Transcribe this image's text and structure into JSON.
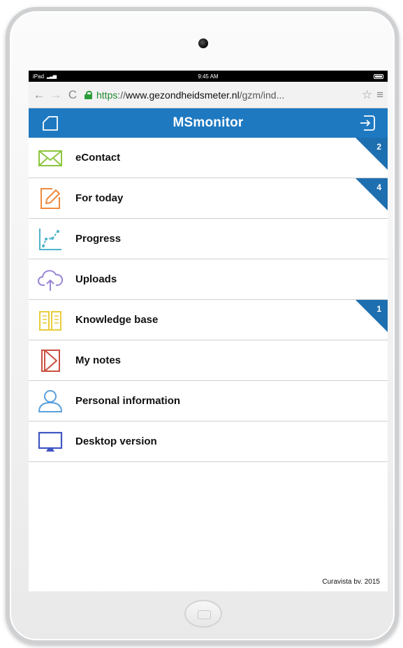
{
  "status_bar": {
    "carrier": "iPad",
    "time": "9:45 AM"
  },
  "browser": {
    "url_scheme": "https",
    "url_sep": "://",
    "url_host": "www.gezondheidsmeter.nl",
    "url_path": "/gzm/ind..."
  },
  "header": {
    "title": "MSmonitor"
  },
  "menu": [
    {
      "label": "eContact",
      "icon": "mail-icon",
      "badge": "2"
    },
    {
      "label": "For today",
      "icon": "edit-icon",
      "badge": "4"
    },
    {
      "label": "Progress",
      "icon": "progress-chart-icon",
      "badge": ""
    },
    {
      "label": "Uploads",
      "icon": "cloud-upload-icon",
      "badge": ""
    },
    {
      "label": "Knowledge base",
      "icon": "book-icon",
      "badge": "1"
    },
    {
      "label": "My notes",
      "icon": "notes-icon",
      "badge": ""
    },
    {
      "label": "Personal information",
      "icon": "person-icon",
      "badge": ""
    },
    {
      "label": "Desktop version",
      "icon": "monitor-icon",
      "badge": ""
    }
  ],
  "footer": {
    "copyright": "Curavista bv. 2015"
  },
  "colors": {
    "accent": "#1e79c1",
    "badge": "#1e6fb0"
  }
}
